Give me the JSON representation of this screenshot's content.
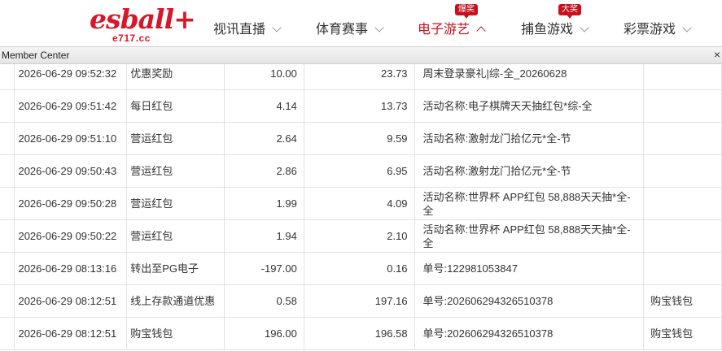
{
  "brand": {
    "logo_text": "esball+",
    "logo_sub": "e717.cc",
    "accent_color": "#d7182a"
  },
  "nav": {
    "items": [
      {
        "label": "视讯直播",
        "badge": ""
      },
      {
        "label": "体育赛事",
        "badge": ""
      },
      {
        "label": "电子游艺",
        "badge": "爆奖",
        "active": true
      },
      {
        "label": "捕鱼游戏",
        "badge": "大奖"
      },
      {
        "label": "彩票游戏",
        "badge": ""
      }
    ]
  },
  "window": {
    "title": "Member Center",
    "close_symbol": "×"
  },
  "records": [
    {
      "time": "2026-06-29 09:52:32",
      "type": "优惠奖励",
      "amount": "10.00",
      "balance": "23.73",
      "note": "周末登录豪礼|综-全_20260628",
      "extra": ""
    },
    {
      "time": "2026-06-29 09:51:42",
      "type": "每日红包",
      "amount": "4.14",
      "balance": "13.73",
      "note": "活动名称:电子棋牌天天抽红包*综-全",
      "extra": ""
    },
    {
      "time": "2026-06-29 09:51:10",
      "type": "营运红包",
      "amount": "2.64",
      "balance": "9.59",
      "note": "活动名称:激射龙门拾亿元*全-节",
      "extra": ""
    },
    {
      "time": "2026-06-29 09:50:43",
      "type": "营运红包",
      "amount": "2.86",
      "balance": "6.95",
      "note": "活动名称:激射龙门拾亿元*全-节",
      "extra": ""
    },
    {
      "time": "2026-06-29 09:50:28",
      "type": "营运红包",
      "amount": "1.99",
      "balance": "4.09",
      "note": "活动名称:世界杯 APP红包 58,888天天抽*全-全",
      "extra": ""
    },
    {
      "time": "2026-06-29 09:50:22",
      "type": "营运红包",
      "amount": "1.94",
      "balance": "2.10",
      "note": "活动名称:世界杯 APP红包 58,888天天抽*全-全",
      "extra": ""
    },
    {
      "time": "2026-06-29 08:13:16",
      "type": "转出至PG电子",
      "amount": "-197.00",
      "balance": "0.16",
      "note": "单号:122981053847",
      "extra": ""
    },
    {
      "time": "2026-06-29 08:12:51",
      "type": "线上存款通道优惠",
      "amount": "0.58",
      "balance": "197.16",
      "note": "单号:202606294326510378",
      "extra": "购宝钱包"
    },
    {
      "time": "2026-06-29 08:12:51",
      "type": "购宝钱包",
      "amount": "196.00",
      "balance": "196.58",
      "note": "单号:202606294326510378",
      "extra": "购宝钱包"
    }
  ]
}
